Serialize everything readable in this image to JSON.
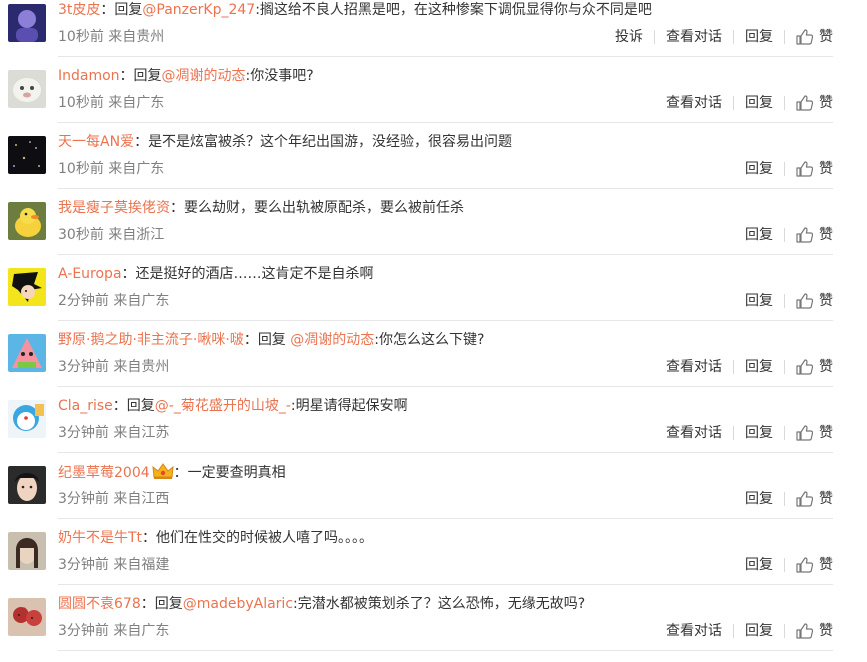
{
  "actions": {
    "report": "投诉",
    "view_conversation": "查看对话",
    "reply": "回复",
    "like": "赞"
  },
  "comments": [
    {
      "username": "3t皮皮",
      "colon": "：",
      "reply_prefix": "回复",
      "mention": "@PanzerKp_247",
      "mention_suffix": ":",
      "text": "搁这给不良人招黑是吧，在这种惨案下调侃显得你与众不同是吧",
      "time": "10秒前",
      "location": "来自贵州",
      "show_report": true,
      "show_view": true
    },
    {
      "username": "Indamon",
      "colon": "：",
      "reply_prefix": "回复",
      "mention": "@凋谢的动态",
      "mention_suffix": ":",
      "text": "你没事吧?",
      "time": "10秒前",
      "location": "来自广东",
      "show_report": false,
      "show_view": true
    },
    {
      "username": "天一每AN爱",
      "colon": "：",
      "reply_prefix": "",
      "mention": "",
      "mention_suffix": "",
      "text": "是不是炫富被杀？这个年纪出国游，没经验，很容易出问题",
      "time": "10秒前",
      "location": "来自广东",
      "show_report": false,
      "show_view": false
    },
    {
      "username": "我是瘦子莫挨佬资",
      "colon": "：",
      "reply_prefix": "",
      "mention": "",
      "mention_suffix": "",
      "text": "要么劫财，要么出轨被原配杀，要么被前任杀",
      "time": "30秒前",
      "location": "来自浙江",
      "show_report": false,
      "show_view": false
    },
    {
      "username": "A-Europa",
      "colon": "：",
      "reply_prefix": "",
      "mention": "",
      "mention_suffix": "",
      "text": "还是挺好的酒店……这肯定不是自杀啊",
      "time": "2分钟前",
      "location": "来自广东",
      "show_report": false,
      "show_view": false
    },
    {
      "username": "野原·鹅之助·非主流子·啾咪·啵",
      "colon": "：",
      "reply_prefix": "回复 ",
      "mention": "@凋谢的动态",
      "mention_suffix": ":",
      "text": "你怎么这么下键?",
      "time": "3分钟前",
      "location": "来自贵州",
      "show_report": false,
      "show_view": true
    },
    {
      "username": "Cla_rise",
      "colon": "：",
      "reply_prefix": "回复",
      "mention": "@-_菊花盛开的山坡_-",
      "mention_suffix": ":",
      "text": "明星请得起保安啊",
      "time": "3分钟前",
      "location": "来自江苏",
      "show_report": false,
      "show_view": true
    },
    {
      "username": "纪墨草莓2004",
      "colon": "：",
      "reply_prefix": "",
      "mention": "",
      "mention_suffix": "",
      "text": "一定要查明真相",
      "time": "3分钟前",
      "location": "来自江西",
      "show_report": false,
      "show_view": false
    },
    {
      "username": "奶牛不是牛Tt",
      "colon": "：",
      "reply_prefix": "",
      "mention": "",
      "mention_suffix": "",
      "text": "他们在性交的时候被人嘻了吗。。。。",
      "time": "3分钟前",
      "location": "来自福建",
      "show_report": false,
      "show_view": false
    },
    {
      "username": "圆圆不袁678",
      "colon": "：",
      "reply_prefix": "回复",
      "mention": "@madebyAlaric",
      "mention_suffix": ":",
      "text": "完潜水都被策划杀了？这么恐怖，无缘无故吗?",
      "time": "3分钟前",
      "location": "来自广东",
      "show_report": false,
      "show_view": true
    }
  ],
  "colors": {
    "username": "#eb7350",
    "meta": "#808080",
    "text": "#333333",
    "divider": "#e6e6e6"
  }
}
